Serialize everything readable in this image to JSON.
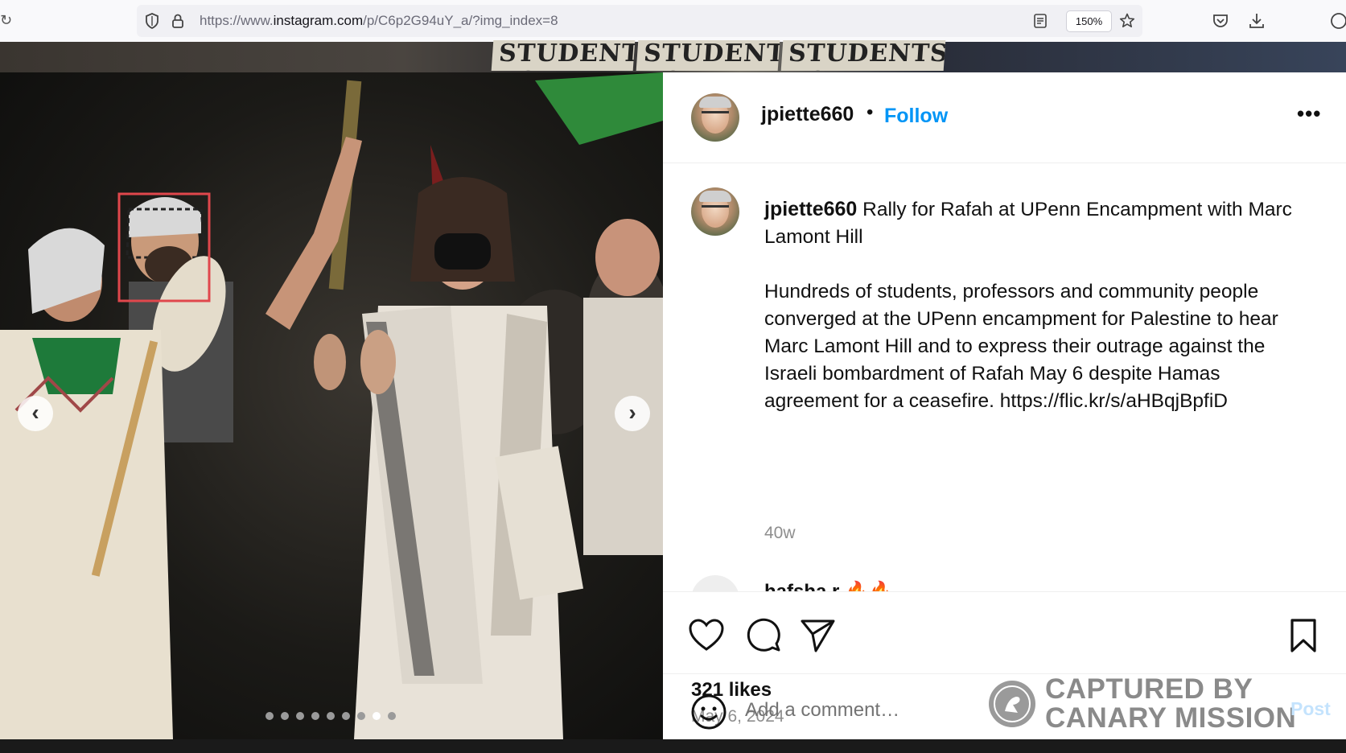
{
  "browser": {
    "url_prefix": "https://www.",
    "url_domain": "instagram.com",
    "url_path": "/p/C6p2G94uY_a/?img_index=8",
    "zoom": "150%",
    "icons": [
      "reload-icon",
      "shield-icon",
      "lock-icon",
      "reader-view-icon",
      "bookmark-star-icon",
      "pocket-icon",
      "download-icon"
    ]
  },
  "backdrop": {
    "signs": [
      "STUDENTS AGREE",
      "STUDENTS AGREE",
      "STUDENTS AGREE"
    ]
  },
  "carousel": {
    "total_slides": 9,
    "active_index": 8,
    "prev_label": "‹",
    "next_label": "›",
    "highlight_box_color": "#e0474c"
  },
  "post": {
    "author": "jpiette660",
    "separator": "•",
    "follow_label": "Follow",
    "more_label": "•••",
    "caption_title": "Rally for Rafah at UPenn Encampment with Marc Lamont Hill",
    "caption_body": "Hundreds of students, professors and community people converged at the UPenn encampment for Palestine to hear Marc Lamont Hill and to express their outrage against the Israeli bombardment of Rafah May 6 despite Hamas agreement for a ceasefire. https://flic.kr/s/aHBqjBpfiD",
    "time_ago": "40w",
    "next_comment_peek": "hafsha.r 🔥🔥",
    "likes": "321 likes",
    "date": "May 6, 2024",
    "comment_placeholder": "Add a comment…",
    "post_label": "Post"
  },
  "watermark": {
    "line1": "CAPTURED BY",
    "line2": "CANARY MISSION"
  },
  "colors": {
    "follow": "#0095f6",
    "post_disabled": "#c4e3fd",
    "muted": "#8e8e8e"
  }
}
